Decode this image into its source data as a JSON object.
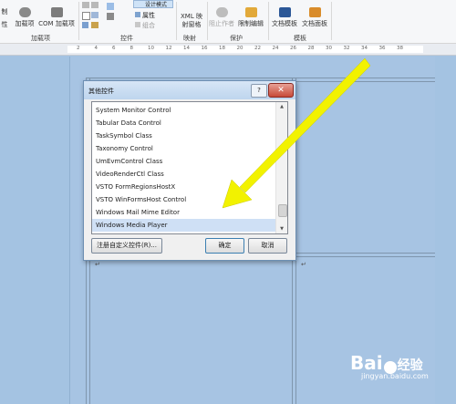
{
  "ribbon": {
    "partial_left_top": "制",
    "partial_left_bottom": "性",
    "addins_label": "加载项",
    "com_addins_label": "COM 加载项",
    "group_addins": "加载项",
    "group_controls": "控件",
    "properties_label": "属性",
    "group_combine_label": "组合",
    "xml_mapping_label": "XML 映射窗格",
    "group_mapping": "映射",
    "block_authors_label": "阻止作者",
    "restrict_editing_label": "限制编辑",
    "group_protect": "保护",
    "doc_template_label": "文档模板",
    "doc_panel_label": "文档面板",
    "group_templates": "模板",
    "design_mode_label": "设计模式"
  },
  "ruler": {
    "ticks": [
      "2",
      "4",
      "6",
      "8",
      "10",
      "12",
      "14",
      "16",
      "18",
      "20",
      "22",
      "24",
      "26",
      "28",
      "30",
      "32",
      "34",
      "36",
      "38"
    ]
  },
  "dialog": {
    "title": "其他控件",
    "help": "?",
    "close": "✕",
    "items": [
      "System Monitor Control",
      "Tabular Data Control",
      "TaskSymbol Class",
      "Taxonomy Control",
      "UmEvmControl Class",
      "VideoRenderCtl Class",
      "VSTO FormRegionsHostX",
      "VSTO WinFormsHost Control",
      "Windows Mail Mime Editor",
      "Windows Media Player"
    ],
    "selected_index": 9,
    "register_button": "注册自定义控件(R)...",
    "ok_button": "确定",
    "cancel_button": "取消"
  },
  "watermark": {
    "brand": "Bai",
    "brand_suffix": "经验",
    "url": "jingyan.baidu.com"
  },
  "colors": {
    "accent_arrow": "#f2f200",
    "selection": "#cfe0f5",
    "page_bg": "#a7c4e3"
  }
}
